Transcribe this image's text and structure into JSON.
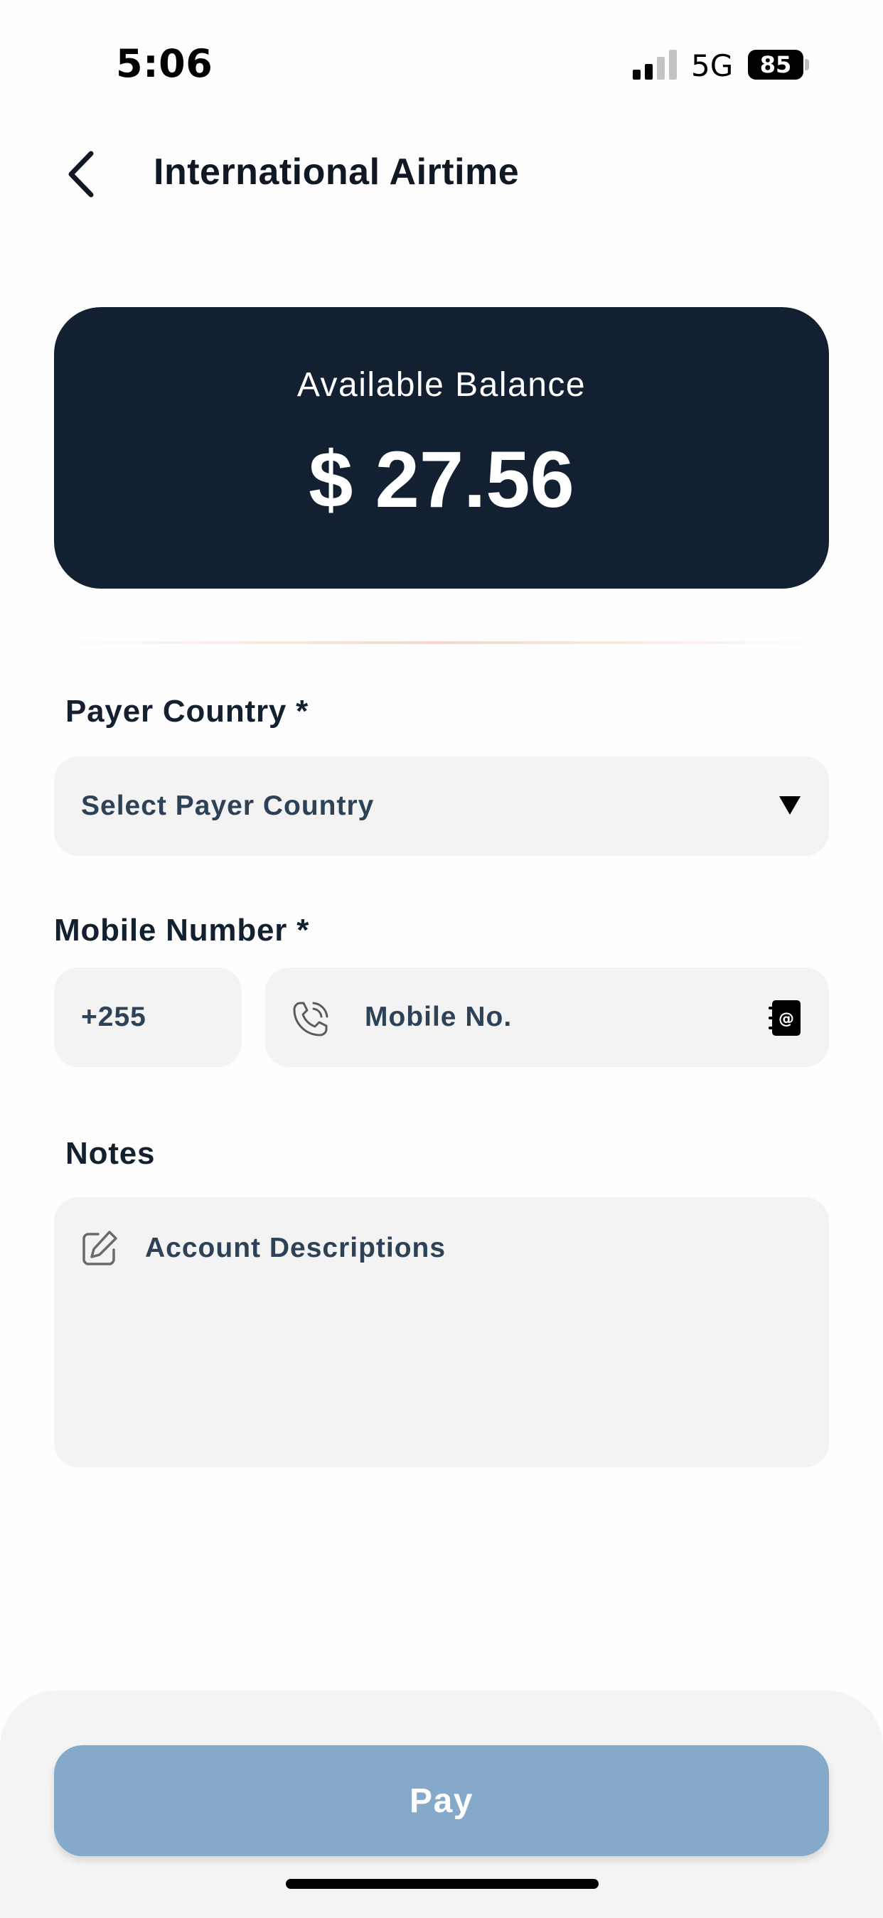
{
  "status_bar": {
    "time": "5:06",
    "network": "5G",
    "battery": "85",
    "icons": [
      "signal-icon",
      "battery-icon"
    ]
  },
  "header": {
    "title": "International Airtime",
    "back_icon": "back-chevron-icon"
  },
  "balance": {
    "label": "Available Balance",
    "amount": "$ 27.56"
  },
  "payer_country": {
    "label": "Payer Country *",
    "placeholder": "Select Payer Country",
    "icon": "dropdown-arrow-icon"
  },
  "mobile_number": {
    "label": "Mobile Number *",
    "country_code": "+255",
    "placeholder": "Mobile No.",
    "icons": [
      "phone-icon",
      "contacts-book-icon"
    ]
  },
  "notes": {
    "label": "Notes",
    "placeholder": "Account Descriptions",
    "icon": "edit-icon"
  },
  "actions": {
    "pay_label": "Pay"
  },
  "colors": {
    "card_background": "#132031",
    "pay_button": "#84a9c9",
    "field_background": "#f3f3f3",
    "placeholder_text": "#2d4157"
  }
}
